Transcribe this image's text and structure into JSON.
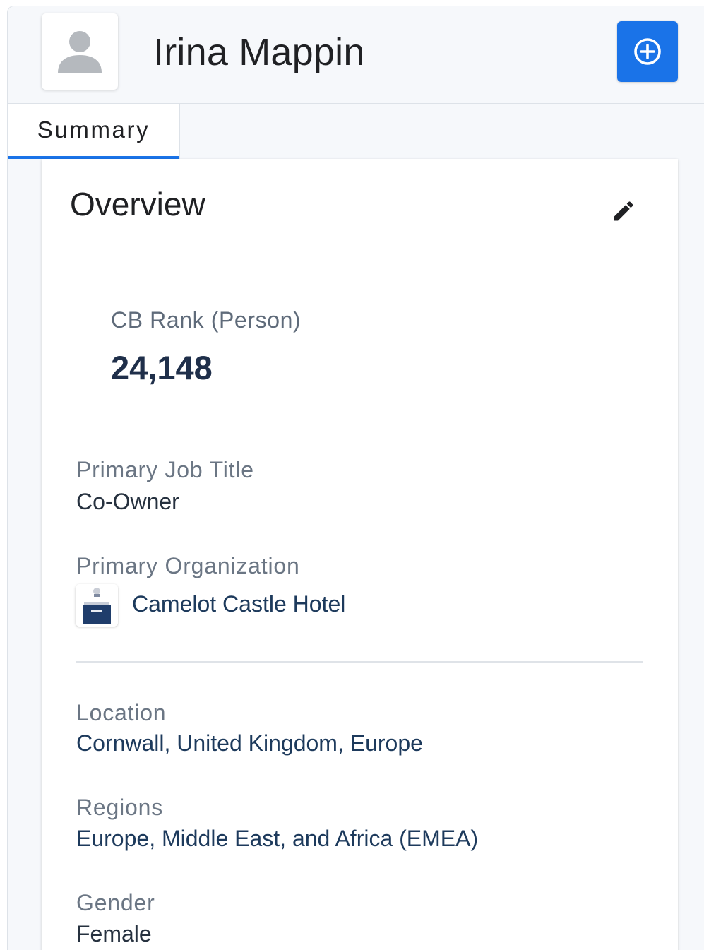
{
  "header": {
    "name": "Irina Mappin"
  },
  "tabs": [
    {
      "label": "Summary"
    }
  ],
  "overview": {
    "title": "Overview",
    "cb_rank_label": "CB Rank (Person)",
    "cb_rank_value": "24,148",
    "job_title_label": "Primary Job Title",
    "job_title_value": "Co-Owner",
    "organization_label": "Primary Organization",
    "organization_value": "Camelot Castle Hotel",
    "location_label": "Location",
    "location_value": "Cornwall, United Kingdom, Europe",
    "regions_label": "Regions",
    "regions_value": "Europe, Middle East, and Africa (EMEA)",
    "gender_label": "Gender",
    "gender_value": "Female"
  },
  "icons": {
    "avatar": "person-icon",
    "add": "add-circle-icon",
    "edit": "pencil-icon",
    "org_logo": "hotel-logo-icon"
  },
  "colors": {
    "accent": "#1a73e8",
    "link": "#1d3a5c",
    "label": "#6b7684"
  }
}
